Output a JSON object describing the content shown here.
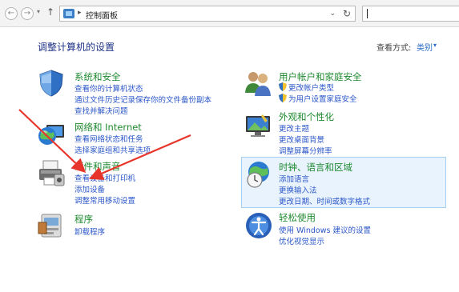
{
  "addressbar": {
    "path": "控制面板",
    "back_glyph": "←",
    "forward_glyph": "→",
    "dropdown_glyph": "▾",
    "up_glyph": "↑",
    "separator_glyph": "▸",
    "chevron_glyph": "⌄",
    "refresh_glyph": "↻",
    "search_value": ""
  },
  "header": {
    "title": "调整计算机的设置",
    "view_by_label": "查看方式:",
    "view_by_value": "类别",
    "view_by_chevron": "▾"
  },
  "categories": [
    {
      "title": "系统和安全",
      "icon": "shield-icon",
      "links": [
        "查看你的计算机状态",
        "通过文件历史记录保存你的文件备份副本",
        "查找并解决问题"
      ]
    },
    {
      "title": "网络和 Internet",
      "icon": "network-globe-icon",
      "links": [
        "查看网络状态和任务",
        "选择家庭组和共享选项"
      ]
    },
    {
      "title": "硬件和声音",
      "icon": "printer-icon",
      "links": [
        "查看设备和打印机",
        "添加设备",
        "调整常用移动设置"
      ]
    },
    {
      "title": "程序",
      "icon": "programs-icon",
      "links": [
        "卸载程序"
      ]
    },
    {
      "title": "用户帐户和家庭安全",
      "icon": "users-icon",
      "links": [
        "更改帐户类型",
        "为用户设置家庭安全"
      ]
    },
    {
      "title": "外观和个性化",
      "icon": "appearance-icon",
      "links": [
        "更改主题",
        "更改桌面背景",
        "调整屏幕分辨率"
      ]
    },
    {
      "title": "时钟、语言和区域",
      "icon": "clock-globe-icon",
      "links": [
        "添加语言",
        "更换输入法",
        "更改日期、时间或数字格式"
      ],
      "highlighted": true
    },
    {
      "title": "轻松使用",
      "icon": "ease-of-access-icon",
      "links": [
        "使用 Windows 建议的设置",
        "优化视觉显示"
      ]
    }
  ],
  "colors": {
    "category_title": "#1e8a2f",
    "link": "#2b57c9",
    "page_title": "#1e3287",
    "highlight_bg": "#e9f3fd",
    "highlight_border": "#a6cdf2",
    "annotation_arrow": "#e8352b"
  }
}
